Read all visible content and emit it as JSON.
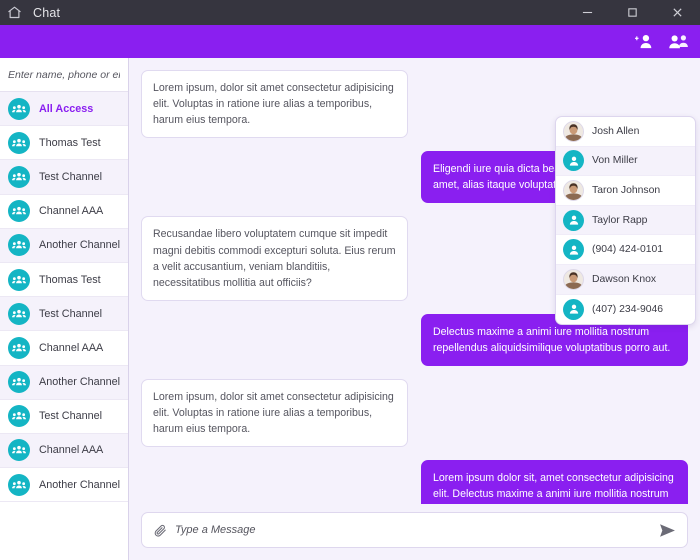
{
  "titlebar": {
    "home_icon": "home-icon",
    "title": "Chat",
    "minimize_label": "—",
    "maximize_label": "□",
    "close_label": "✕"
  },
  "header": {
    "accent_color": "#8a1ff0",
    "add_person_icon": "add-person-icon",
    "group_icon": "group-people-icon"
  },
  "sidebar": {
    "search": {
      "placeholder": "Enter name, phone or email",
      "value": ""
    },
    "items": [
      {
        "label": "All Access",
        "icon": "group-icon",
        "active": true
      },
      {
        "label": "Thomas Test",
        "icon": "group-icon",
        "active": false
      },
      {
        "label": "Test Channel",
        "icon": "group-icon",
        "active": false
      },
      {
        "label": "Channel AAA",
        "icon": "group-icon",
        "active": false
      },
      {
        "label": "Another Channel",
        "icon": "group-icon",
        "active": false
      },
      {
        "label": "Thomas Test",
        "icon": "group-icon",
        "active": false
      },
      {
        "label": "Test Channel",
        "icon": "group-icon",
        "active": false
      },
      {
        "label": "Channel AAA",
        "icon": "group-icon",
        "active": false
      },
      {
        "label": "Another Channel",
        "icon": "group-icon",
        "active": false
      },
      {
        "label": "Test Channel",
        "icon": "group-icon",
        "active": false
      },
      {
        "label": "Channel AAA",
        "icon": "group-icon",
        "active": false
      },
      {
        "label": "Another Channel",
        "icon": "group-icon",
        "active": false
      }
    ]
  },
  "conversation": {
    "messages": [
      {
        "direction": "in",
        "text": "Lorem ipsum, dolor sit amet consectetur adipisicing elit. Voluptas in ratione iure alias a temporibus, harum eius tempora."
      },
      {
        "direction": "out",
        "text": "Eligendi iure quia dicta beatae ab, minima. Aliquam amet, alias itaque voluptate vel tempora."
      },
      {
        "direction": "in",
        "text": "Recusandae libero voluptatem cumque sit impedit magni debitis commodi excepturi soluta. Eius rerum a velit accusantium, veniam blanditiis, necessitatibus mollitia aut officiis?"
      },
      {
        "direction": "out",
        "text": "Delectus maxime a animi iure mollitia nostrum repellendus aliquidsimilique voluptatibus porro aut."
      },
      {
        "direction": "in",
        "text": "Lorem ipsum, dolor sit amet consectetur adipisicing elit. Voluptas in ratione iure alias a temporibus, harum eius tempora."
      },
      {
        "direction": "out",
        "text": "Lorem ipsum dolor sit, amet consectetur adipisicing elit. Delectus maxime a animi iure mollitia nostrum repellendus aliquid dolor dignissimos, cum amet facilis."
      }
    ]
  },
  "composer": {
    "attach_icon": "paperclip-icon",
    "placeholder": "Type a Message",
    "value": "",
    "send_icon": "send-icon"
  },
  "contacts_panel": {
    "items": [
      {
        "label": "Josh Allen",
        "avatar": "photo"
      },
      {
        "label": "Von Miller",
        "avatar": "icon"
      },
      {
        "label": "Taron Johnson",
        "avatar": "photo"
      },
      {
        "label": "Taylor Rapp",
        "avatar": "icon"
      },
      {
        "label": "(904) 424-0101",
        "avatar": "icon"
      },
      {
        "label": "Dawson Knox",
        "avatar": "photo"
      },
      {
        "label": "(407) 234-9046",
        "avatar": "icon"
      }
    ]
  }
}
